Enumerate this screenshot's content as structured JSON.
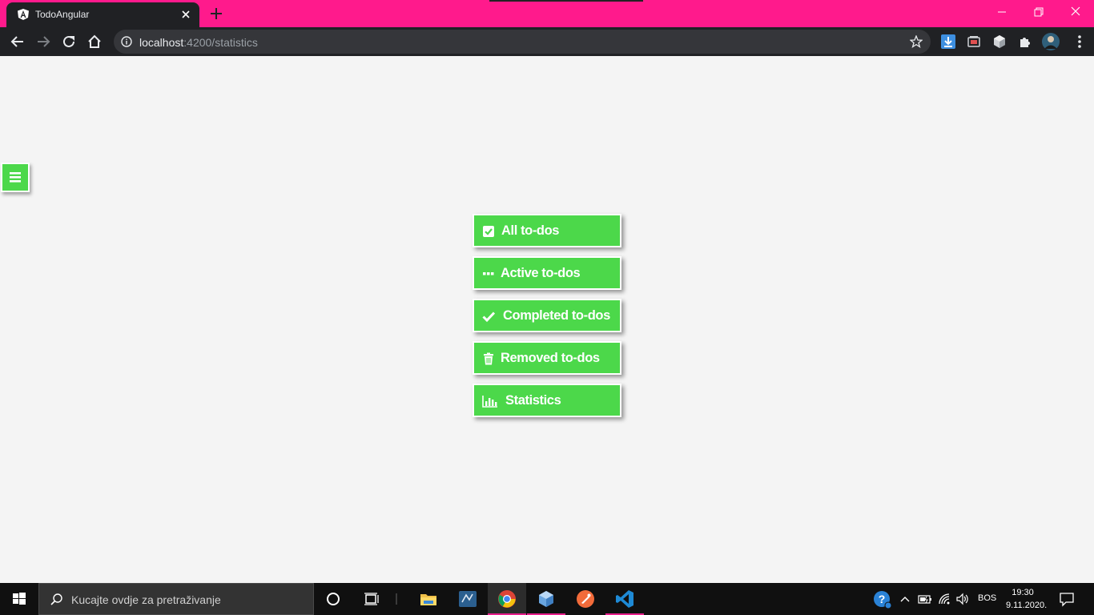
{
  "browser": {
    "tab_title": "TodoAngular",
    "url_host": "localhost",
    "url_path": ":4200/statistics"
  },
  "page": {
    "nav_items": [
      {
        "label": "All to-dos",
        "icon": "check-square-icon"
      },
      {
        "label": "Active to-dos",
        "icon": "ellipsis-icon"
      },
      {
        "label": "Completed to-dos",
        "icon": "checkmark-icon"
      },
      {
        "label": "Removed to-dos",
        "icon": "trash-icon"
      },
      {
        "label": "Statistics",
        "icon": "bar-chart-icon"
      }
    ],
    "accent_color": "#4cd84a"
  },
  "taskbar": {
    "search_placeholder": "Kucajte ovdje za pretraživanje",
    "language": "BOS",
    "time": "19:30",
    "date": "9.11.2020.",
    "accent_color": "#e91e8c"
  },
  "titlebar_color": "#ff1a8c"
}
